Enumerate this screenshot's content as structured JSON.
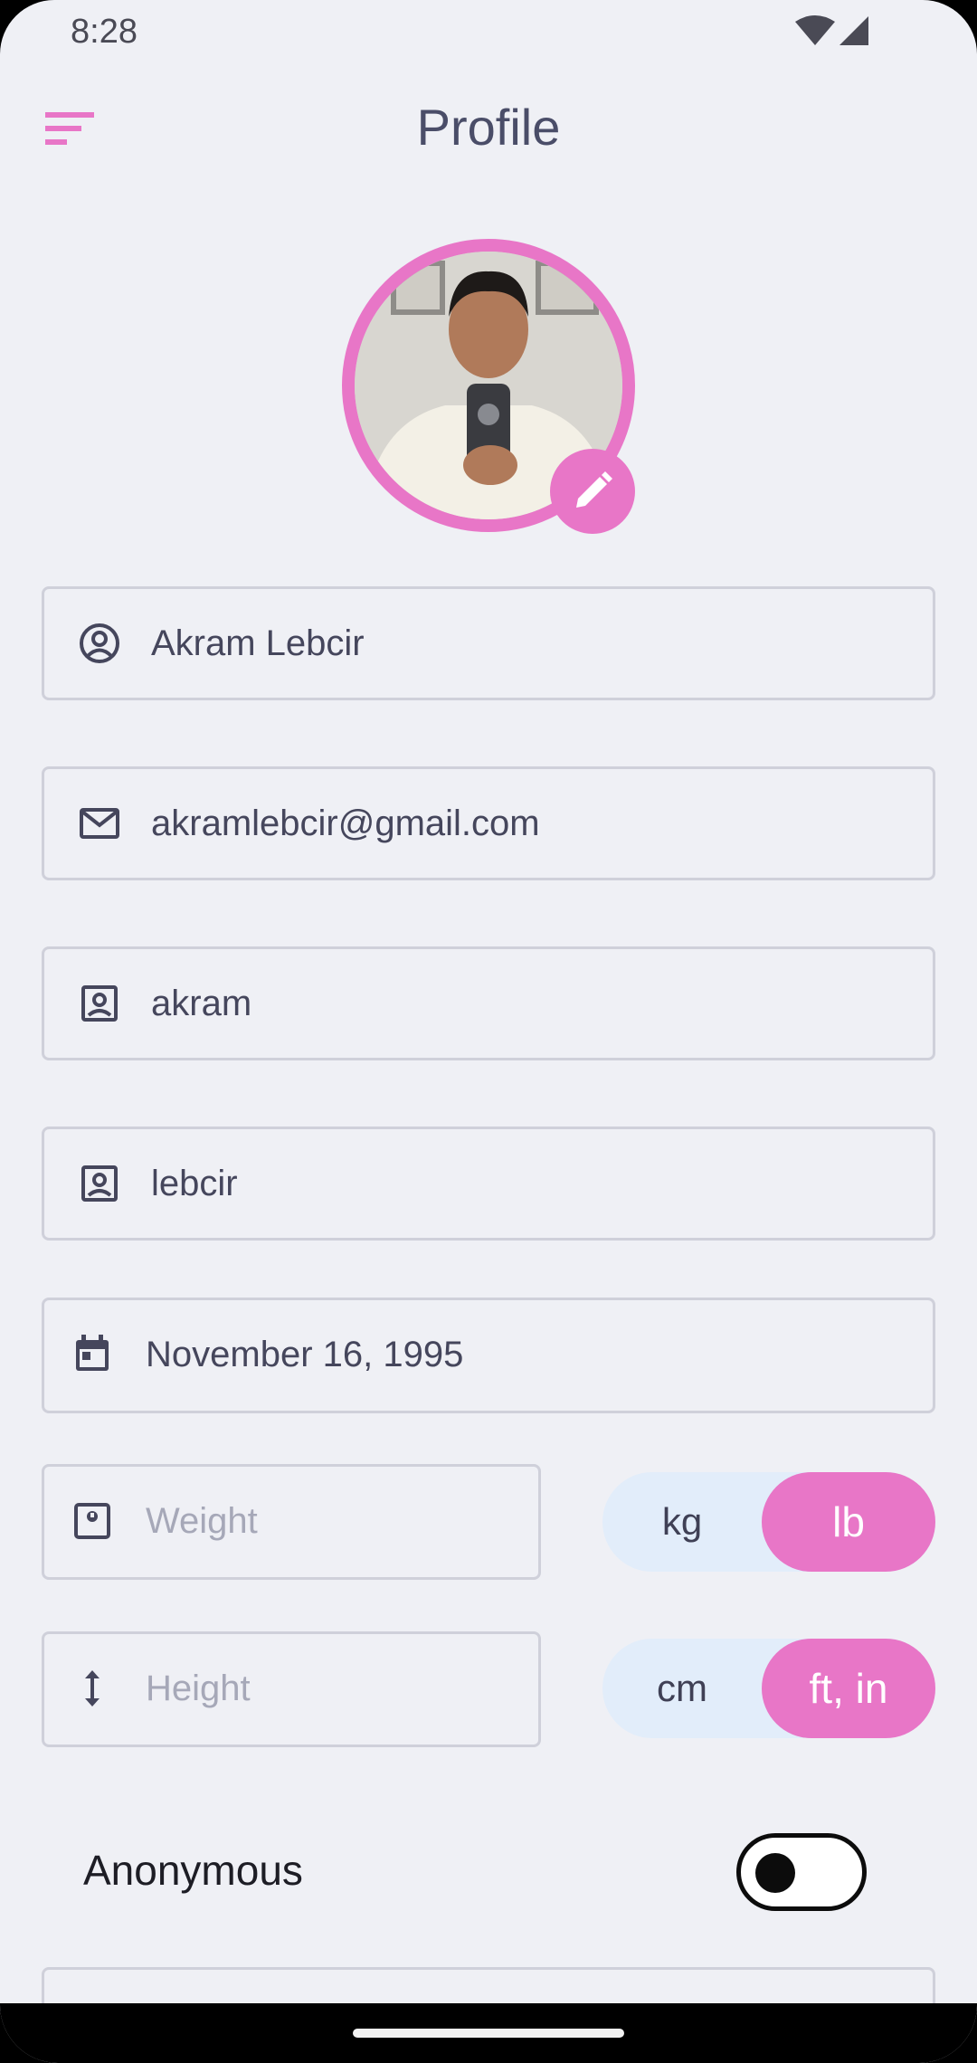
{
  "status_bar": {
    "time": "8:28"
  },
  "app_bar": {
    "title": "Profile"
  },
  "fields": {
    "full_name": "Akram Lebcir",
    "email": "akramlebcir@gmail.com",
    "first_name": "akram",
    "last_name": "lebcir",
    "birth_date": "November 16, 1995",
    "weight_placeholder": "Weight",
    "height_placeholder": "Height"
  },
  "weight_units": {
    "left": "kg",
    "right": "lb",
    "selected": "lb"
  },
  "height_units": {
    "left": "cm",
    "right": "ft, in",
    "selected": "ft, in"
  },
  "anonymous": {
    "label": "Anonymous",
    "enabled": false
  },
  "colors": {
    "accent": "#e876c7",
    "background": "#eff0f5",
    "toggle_bg": "#e2edfa"
  }
}
